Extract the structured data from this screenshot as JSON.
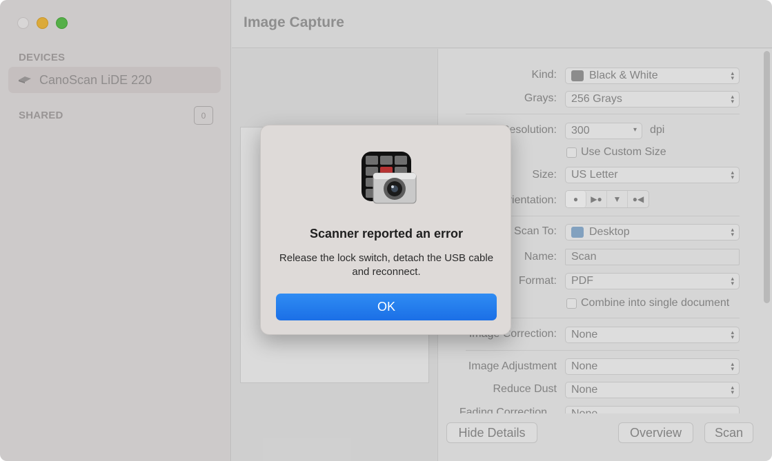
{
  "window": {
    "app_title": "Image Capture",
    "traffic_lights": {
      "close_color": "#f3f0f0",
      "minimize_color": "#f6bd3b",
      "maximize_color": "#5ac34b"
    }
  },
  "sidebar": {
    "devices_heading": "DEVICES",
    "device": {
      "name": "CanoScan LiDE 220",
      "icon": "scanner-icon"
    },
    "shared_heading": "SHARED",
    "shared_count": "0"
  },
  "details": {
    "kind": {
      "label": "Kind:",
      "value": "Black & White",
      "icon": "bw-image-icon"
    },
    "grays": {
      "label": "Grays:",
      "value": "256 Grays"
    },
    "resolution": {
      "label": "Resolution:",
      "value": "300",
      "unit": "dpi"
    },
    "custom_size": {
      "label": "Use Custom Size",
      "checked": false
    },
    "size": {
      "label": "Size:",
      "value": "US Letter"
    },
    "orientation": {
      "label": "Orientation:",
      "options": [
        "portrait",
        "landscape-left",
        "upside-down",
        "landscape-right"
      ],
      "selected": "portrait"
    },
    "scan_to": {
      "label": "Scan To:",
      "value": "Desktop",
      "icon": "folder-icon"
    },
    "name": {
      "label": "Name:",
      "value": "Scan"
    },
    "format": {
      "label": "Format:",
      "value": "PDF"
    },
    "combine": {
      "label": "Combine into single document",
      "checked": false
    },
    "image_correction": {
      "label": "Image Correction:",
      "value": "None"
    },
    "image_adjustment": {
      "label": "Image Adjustment",
      "value": "None"
    },
    "reduce_dust": {
      "label": "Reduce Dust",
      "value": "None"
    },
    "fading_correction": {
      "label": "Fading Correction",
      "value": "None"
    }
  },
  "footer": {
    "hide_details": "Hide Details",
    "overview": "Overview",
    "scan": "Scan"
  },
  "alert": {
    "icon": "image-capture-app-icon",
    "title": "Scanner reported an error",
    "message": "Release the lock switch, detach the USB cable and reconnect.",
    "ok_label": "OK",
    "ok_color": "#1b6fe6"
  }
}
